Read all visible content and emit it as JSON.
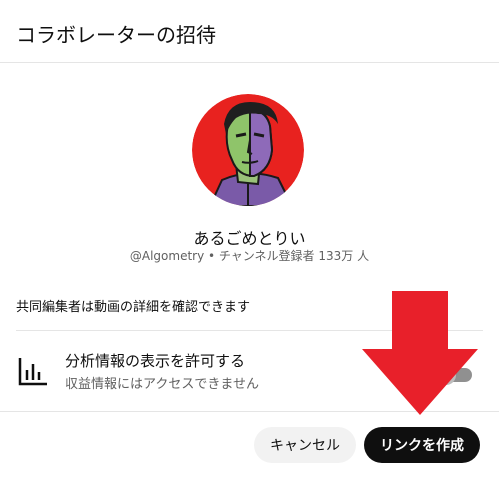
{
  "dialog": {
    "title": "コラボレーターの招待"
  },
  "channel": {
    "name": "あるごめとりい",
    "meta": "@Algometry • チャンネル登録者 133万 人",
    "avatar_bg": "#e8221f"
  },
  "editor_note": "共同編集者は動画の詳細を確認できます",
  "analytics": {
    "title": "分析情報の表示を許可する",
    "subtitle": "収益情報にはアクセスできません",
    "icon": "bar-chart-icon",
    "toggle_on": false
  },
  "buttons": {
    "cancel": "キャンセル",
    "create": "リンクを作成"
  },
  "colors": {
    "overlay_arrow": "#e8202a",
    "primary_button": "#0f0f0f",
    "secondary_button": "#f2f2f2"
  }
}
